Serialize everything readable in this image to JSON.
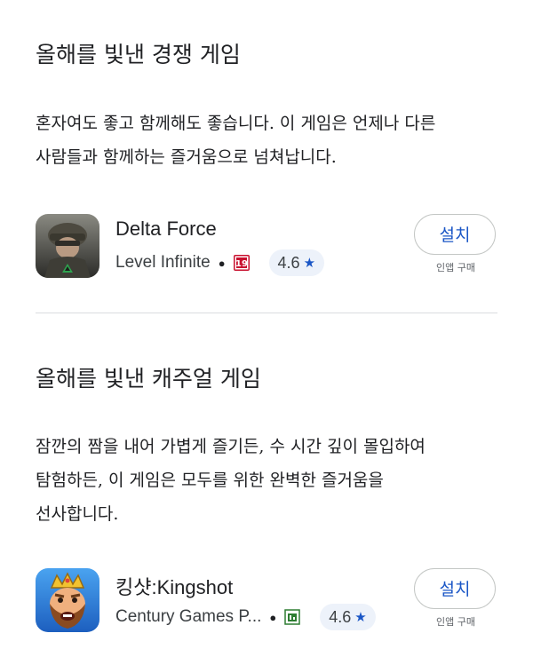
{
  "sections": [
    {
      "title": "올해를 빛낸 경쟁 게임",
      "description_lines": [
        "혼자여도 좋고 함께해도 좋습니다. 이 게임은 언제나 다른",
        "사람들과 함께하는 즐거움으로 넘쳐납니다."
      ],
      "app": {
        "name": "Delta Force",
        "developer": "Level Infinite",
        "age_rating": "19",
        "rating": "4.6",
        "install_label": "설치",
        "in_app_purchase": "인앱 구매",
        "icon": "delta-force-soldier-icon"
      }
    },
    {
      "title": "올해를 빛낸 캐주얼 게임",
      "description_lines": [
        "잠깐의 짬을 내어 가볍게 즐기든, 수 시간 깊이 몰입하여",
        "탐험하든, 이 게임은 모두를 위한 완벽한 즐거움을",
        "선사합니다."
      ],
      "app": {
        "name": "킹샷:Kingshot",
        "developer": "Century Games P...",
        "age_rating": "All",
        "rating": "4.6",
        "install_label": "설치",
        "in_app_purchase": "인앱 구매",
        "icon": "kingshot-king-icon"
      }
    }
  ],
  "colors": {
    "accent": "#1a56c6",
    "rating_pill_bg": "#edf2fa",
    "divider": "#dadce0",
    "age_19": "#c8102e",
    "age_all": "#2e7d32"
  }
}
